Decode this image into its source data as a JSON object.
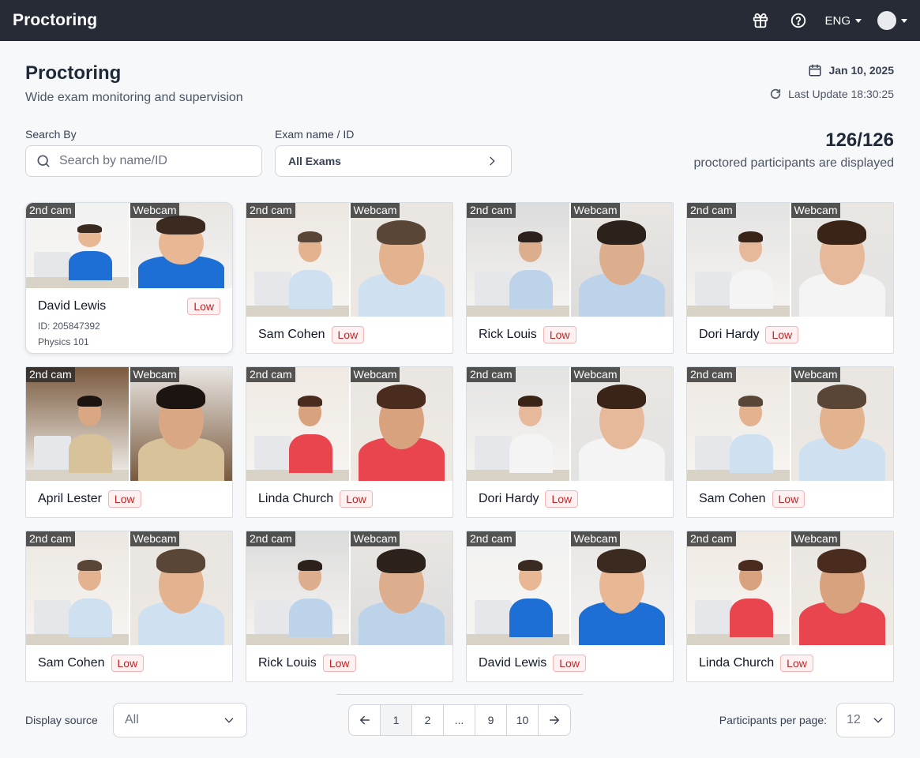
{
  "app": {
    "brand": "Proctoring",
    "language": "ENG"
  },
  "icons": {
    "gift": "gift-icon",
    "help": "help-icon",
    "calendar": "calendar-icon",
    "refresh": "refresh-icon",
    "search": "search-icon",
    "chevron": "chevron-right-icon"
  },
  "header": {
    "title": "Proctoring",
    "subtitle": "Wide exam monitoring and supervision",
    "date": "Jan 10, 2025",
    "last_update": "Last Update 18:30:25"
  },
  "filters": {
    "search_label": "Search By",
    "search_placeholder": "Search by name/ID",
    "exam_label": "Exam name / ID",
    "exam_value": "All Exams"
  },
  "count": {
    "value": "126/126",
    "text": "proctored participants are displayed"
  },
  "cam_labels": {
    "second": "2nd cam",
    "webcam": "Webcam"
  },
  "participants": [
    {
      "name": "David Lewis",
      "risk": "Low",
      "id_text": "ID: 205847392",
      "course": "Physics 101",
      "expanded": true,
      "shirt": "#1d6fd6",
      "hair": "#3b2a20",
      "skin": "#e8b894",
      "bg": "#f2f2f2"
    },
    {
      "name": "Sam Cohen",
      "risk": "Low",
      "shirt": "#cfe0f0",
      "hair": "#5a4636",
      "skin": "#e3b28f",
      "bg": "#ece7e1"
    },
    {
      "name": "Rick Louis",
      "risk": "Low",
      "shirt": "#bdd3ea",
      "hair": "#2c211b",
      "skin": "#ddae8d",
      "bg": "#dcdcdc"
    },
    {
      "name": "Dori Hardy",
      "risk": "Low",
      "shirt": "#f4f4f4",
      "hair": "#3a2418",
      "skin": "#e6b99a",
      "bg": "#e3e3e3"
    },
    {
      "name": "April Lester",
      "risk": "Low",
      "shirt": "#d8c29a",
      "hair": "#1c1410",
      "skin": "#d9a784",
      "bg": "#7a5a3e"
    },
    {
      "name": "Linda Church",
      "risk": "Low",
      "shirt": "#e8454e",
      "hair": "#4a2c1e",
      "skin": "#d9a27f",
      "bg": "#efe9e2"
    },
    {
      "name": "Dori Hardy",
      "risk": "Low",
      "shirt": "#f4f4f4",
      "hair": "#3a2418",
      "skin": "#e6b99a",
      "bg": "#e3e3e3"
    },
    {
      "name": "Sam Cohen",
      "risk": "Low",
      "shirt": "#cfe0f0",
      "hair": "#5a4636",
      "skin": "#e3b28f",
      "bg": "#ece7e1"
    },
    {
      "name": "Sam Cohen",
      "risk": "Low",
      "shirt": "#cfe0f0",
      "hair": "#5a4636",
      "skin": "#e3b28f",
      "bg": "#ece7e1"
    },
    {
      "name": "Rick Louis",
      "risk": "Low",
      "shirt": "#bdd3ea",
      "hair": "#2c211b",
      "skin": "#ddae8d",
      "bg": "#dcdcdc"
    },
    {
      "name": "David Lewis",
      "risk": "Low",
      "shirt": "#1d6fd6",
      "hair": "#3b2a20",
      "skin": "#e8b894",
      "bg": "#f2f2f2"
    },
    {
      "name": "Linda Church",
      "risk": "Low",
      "shirt": "#e8454e",
      "hair": "#4a2c1e",
      "skin": "#d9a27f",
      "bg": "#efe9e2"
    }
  ],
  "footer": {
    "display_source_label": "Display source",
    "display_source_value": "All",
    "pages": [
      "1",
      "2",
      "...",
      "9",
      "10"
    ],
    "current_page": "1",
    "per_page_label": "Participants per page:",
    "per_page_value": "12"
  },
  "colors": {
    "topbar": "#262b36",
    "risk_text": "#c02626",
    "risk_bg": "#fff1f1"
  }
}
